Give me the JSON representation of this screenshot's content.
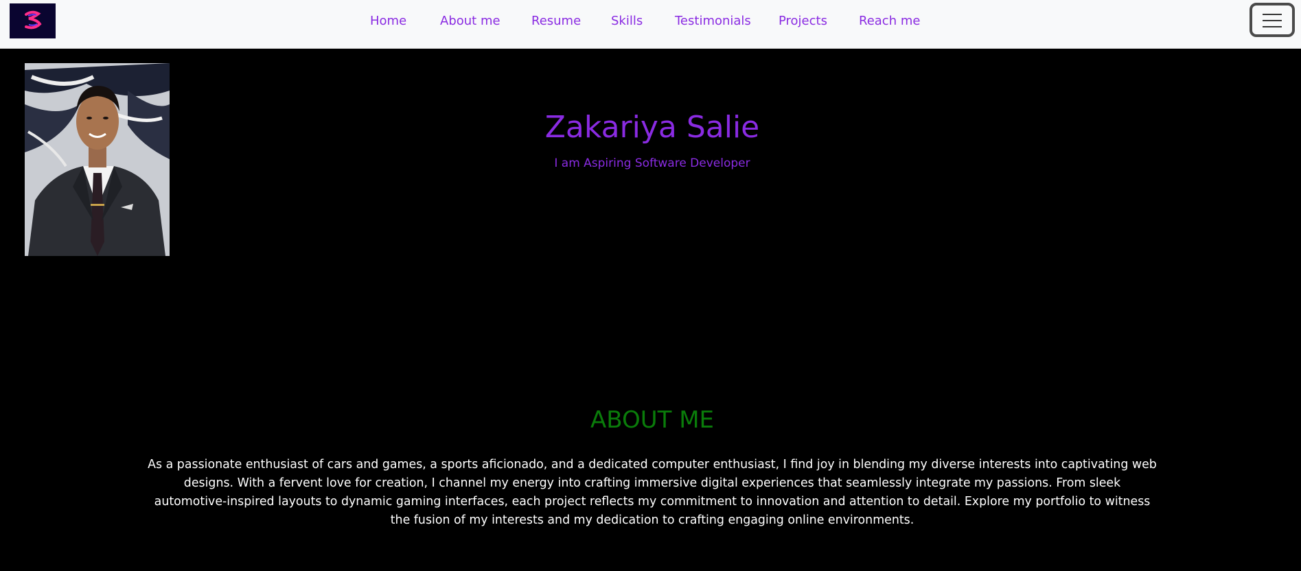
{
  "nav": {
    "logo_icon": "brand-logo-icon",
    "links": [
      "Home",
      "About me",
      "Resume",
      "Skills",
      "Testimonials",
      "Projects",
      "Reach me"
    ],
    "toggler_icon": "hamburger-menu-icon"
  },
  "hero": {
    "photo": "profile-photo",
    "name": "Zakariya Salie",
    "tagline": "I am Aspiring Software Developer"
  },
  "about": {
    "title": "ABOUT ME",
    "body": "As a passionate enthusiast of cars and games, a sports aficionado, and a dedicated computer enthusiast, I find joy in blending my diverse interests into captivating web designs. With a fervent love for creation, I channel my energy into crafting immersive digital experiences that seamlessly integrate my passions. From sleek automotive-inspired layouts to dynamic gaming interfaces, each project reflects my commitment to innovation and attention to detail. Explore my portfolio to witness the fusion of my interests and my dedication to crafting engaging online environments."
  },
  "colors": {
    "accent": "#8a2be2",
    "about_heading": "#0a7c0a",
    "background": "#000000",
    "navbar": "#f8f9fa"
  }
}
